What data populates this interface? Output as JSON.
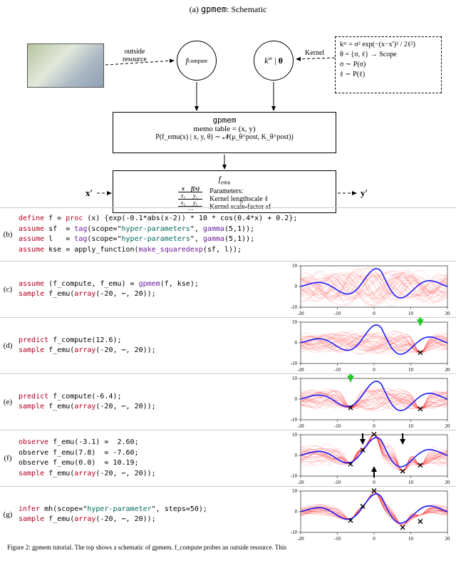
{
  "title": "(a) gpmem: Schematic",
  "schematic": {
    "resource_label": "outside\nresource",
    "kernel_arrow_label": "Kernel",
    "fcompute": "f_compute",
    "kse": "kˢᵉ | θ",
    "kernel_box": {
      "l1": "kˢᵉ = σ² exp(−(x−x′)² / 2ℓ²)",
      "l2": "θ   = {σ, ℓ} → Scope",
      "l3": "σ  ∼ P(σ)",
      "l4": "ℓ  ∼ P(ℓ)"
    },
    "gpmem_box": {
      "title": "gpmem",
      "l2": "memo table = (x, y)",
      "l3": "P(f_emu(x) | x, y, θ) ∼ 𝓝(μ_θ^post, K_θ^post))"
    },
    "femu_box": {
      "title": "f_emu",
      "params_title": "Parameters:",
      "p1": "Kernel lengthscale ℓ",
      "p2": "Kernel scale-factor sf",
      "table": {
        "h1": "x",
        "h2": "f(x)",
        "r1c1": "x₁",
        "r1c2": "y₁",
        "r2c1": "x₂",
        "r2c2": "y₂",
        "r3": "⋯"
      }
    },
    "xin": "x′",
    "yout": "y′"
  },
  "rows": {
    "b": {
      "label": "(b)",
      "lines": [
        {
          "k": "define",
          "rest": " f = ",
          "k2": "proc",
          "rest2": " (x) {exp(-0.1*abs(x-2)) * 10 * cos(0.4*x) + 0.2};"
        },
        {
          "k": "assume",
          "rest": " sf  = ",
          "fn": "tag",
          "rest2": "(scope=\"",
          "str": "hyper-parameters",
          "rest3": "\", ",
          "fn2": "gamma",
          "rest4": "(5,1));"
        },
        {
          "k": "assume",
          "rest": " l   = ",
          "fn": "tag",
          "rest2": "(scope=\"",
          "str": "hyper-parameters",
          "rest3": "\", ",
          "fn2": "gamma",
          "rest4": "(5,1));"
        },
        {
          "k": "assume",
          "rest": " kse = apply_function(",
          "fn": "make_squaredexp",
          "rest2": "(sf, l));"
        }
      ]
    },
    "c": {
      "label": "(c)",
      "code": "assume (f_compute, f_emu) = gpmem(f, kse);\nsample f_emu(array(-20, ⋯, 20));",
      "kw": [
        "assume",
        "sample",
        "array"
      ],
      "fn": [
        "gpmem"
      ]
    },
    "d": {
      "label": "(d)",
      "code": "predict f_compute(12.6);\nsample f_emu(array(-20, ⋯, 20));",
      "kw": [
        "predict",
        "sample",
        "array"
      ]
    },
    "e": {
      "label": "(e)",
      "code": "predict f_compute(-6.4);\nsample f_emu(array(-20, ⋯, 20));",
      "kw": [
        "predict",
        "sample",
        "array"
      ]
    },
    "f": {
      "label": "(f)",
      "code": "observe f_emu(-3.1) =  2.60;\nobserve f_emu(7.8)  = -7.60;\nobserve f_emu(0.0)  = 10.19;\nsample f_emu(array(-20, ⋯, 20));",
      "kw": [
        "observe",
        "observe",
        "observe",
        "sample",
        "array"
      ]
    },
    "g": {
      "label": "(g)",
      "code": "infer mh(scope=\"hyper-parameter\", steps=50);\nsample f_emu(array(-20, ⋯, 20));",
      "kw": [
        "infer",
        "sample",
        "array"
      ],
      "str": [
        "hyper-parameter"
      ]
    }
  },
  "chart_data": [
    {
      "panel": "c",
      "type": "line",
      "xlim": [
        -20,
        20
      ],
      "ylim": [
        -10,
        10
      ],
      "xticks": [
        -20,
        -10,
        0,
        10,
        20
      ],
      "yticks": [
        -10,
        0,
        10
      ],
      "series": [
        {
          "name": "f_true",
          "color": "#1a1aff"
        },
        {
          "name": "prior_samples",
          "color": "#ff3b3b",
          "count": 40
        }
      ],
      "observations": []
    },
    {
      "panel": "d",
      "type": "line",
      "xlim": [
        -20,
        20
      ],
      "ylim": [
        -10,
        10
      ],
      "xticks": [
        -20,
        -10,
        0,
        10,
        20
      ],
      "yticks": [
        -10,
        0,
        10
      ],
      "series": [
        {
          "name": "f_true",
          "color": "#1a1aff"
        },
        {
          "name": "posterior_samples",
          "color": "#ff3b3b",
          "count": 40
        }
      ],
      "observations": [
        {
          "x": 12.6,
          "y": -4.7
        }
      ],
      "green_arrow": {
        "x": 12.6,
        "y": 8
      }
    },
    {
      "panel": "e",
      "type": "line",
      "xlim": [
        -20,
        20
      ],
      "ylim": [
        -10,
        10
      ],
      "xticks": [
        -20,
        -10,
        0,
        10,
        20
      ],
      "yticks": [
        -10,
        0,
        10
      ],
      "series": [
        {
          "name": "f_true",
          "color": "#1a1aff"
        },
        {
          "name": "posterior_samples",
          "color": "#ff3b3b",
          "count": 40
        }
      ],
      "observations": [
        {
          "x": -6.4,
          "y": -4.2
        },
        {
          "x": 12.6,
          "y": -4.7
        }
      ],
      "green_arrow": {
        "x": -6.4,
        "y": 3
      }
    },
    {
      "panel": "f",
      "type": "line",
      "xlim": [
        -20,
        20
      ],
      "ylim": [
        -10,
        10
      ],
      "xticks": [
        -20,
        -10,
        0,
        10,
        20
      ],
      "yticks": [
        -10,
        0,
        10
      ],
      "series": [
        {
          "name": "f_true",
          "color": "#1a1aff"
        },
        {
          "name": "posterior_samples",
          "color": "#ff3b3b",
          "count": 40
        }
      ],
      "observations": [
        {
          "x": -6.4,
          "y": -4.2
        },
        {
          "x": -3.1,
          "y": 2.6
        },
        {
          "x": 0.0,
          "y": 10.19
        },
        {
          "x": 7.8,
          "y": -7.6
        },
        {
          "x": 12.6,
          "y": -4.7
        }
      ],
      "black_arrows": [
        {
          "x": -3.1,
          "dir": "down"
        },
        {
          "x": 0.0,
          "dir": "up"
        },
        {
          "x": 7.8,
          "dir": "down"
        }
      ]
    },
    {
      "panel": "g",
      "type": "line",
      "xlim": [
        -20,
        20
      ],
      "ylim": [
        -10,
        10
      ],
      "xticks": [
        -20,
        -10,
        0,
        10,
        20
      ],
      "yticks": [
        -10,
        0,
        10
      ],
      "series": [
        {
          "name": "f_true",
          "color": "#1a1aff"
        },
        {
          "name": "posterior_samples",
          "color": "#ff3b3b",
          "count": 40
        }
      ],
      "observations": [
        {
          "x": -6.4,
          "y": -4.2
        },
        {
          "x": -3.1,
          "y": 2.6
        },
        {
          "x": 0.0,
          "y": 10.19
        },
        {
          "x": 7.8,
          "y": -7.6
        },
        {
          "x": 12.6,
          "y": -4.7
        }
      ]
    }
  ],
  "f_true": {
    "formula": "10*exp(-0.1*|x-2|)*cos(0.4*x)+0.2",
    "note": "used to draw the blue curve in every panel"
  },
  "caption": "Figure 2: gpmem tutorial. The top shows a schematic of gpmem. f_compute probes an outside resource. This"
}
